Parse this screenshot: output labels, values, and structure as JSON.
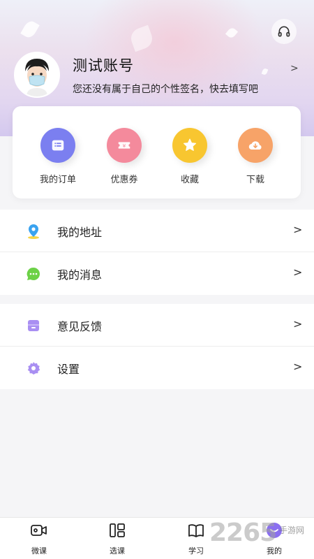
{
  "profile": {
    "name": "测试账号",
    "signature": "您还没有属于自己的个性签名，快去填写吧",
    "arrow": ">"
  },
  "quick_actions": [
    {
      "label": "我的订单",
      "icon": "order-list-icon",
      "color": "#7b7ff0"
    },
    {
      "label": "优惠券",
      "icon": "coupon-icon",
      "color": "#f48a9c"
    },
    {
      "label": "收藏",
      "icon": "star-icon",
      "color": "#f8c630"
    },
    {
      "label": "下载",
      "icon": "download-cloud-icon",
      "color": "#f7a368"
    }
  ],
  "menu_group_1": [
    {
      "label": "我的地址",
      "icon": "location-pin-icon",
      "arrow": ">"
    },
    {
      "label": "我的消息",
      "icon": "chat-bubble-icon",
      "arrow": ">"
    }
  ],
  "menu_group_2": [
    {
      "label": "意见反馈",
      "icon": "feedback-icon",
      "arrow": ">"
    },
    {
      "label": "设置",
      "icon": "settings-gear-icon",
      "arrow": ">"
    }
  ],
  "tabbar": [
    {
      "label": "微课",
      "icon": "video-camera-icon"
    },
    {
      "label": "选课",
      "icon": "grid-select-icon"
    },
    {
      "label": "学习",
      "icon": "book-icon"
    },
    {
      "label": "我的",
      "icon": "profile-icon"
    }
  ],
  "watermark": {
    "text": "2265",
    "sub": "手游网"
  },
  "colors": {
    "accent": "#8a6ff0",
    "header_top": "#eef0f8",
    "header_bottom": "#cfc4ee"
  }
}
